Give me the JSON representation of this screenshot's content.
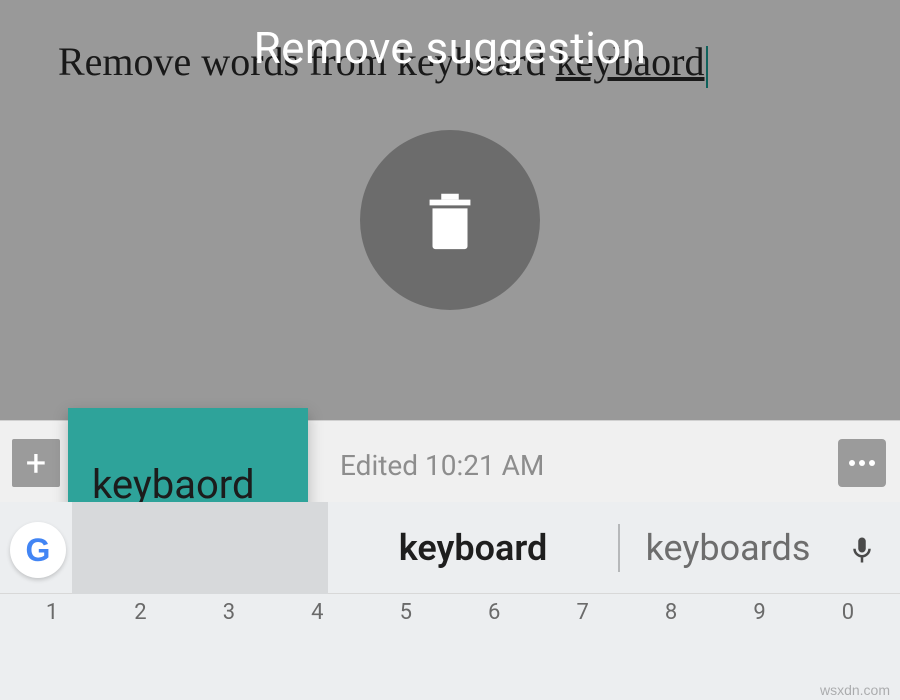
{
  "document": {
    "text_prefix": "Remove words from keyboard ",
    "misspelled_word": "keybaord"
  },
  "overlay": {
    "title": "Remove suggestion"
  },
  "toolbar": {
    "plus_label": "+",
    "edited_label": "Edited 10:21 AM"
  },
  "drag_chip": {
    "text": "keybaord"
  },
  "keyboard": {
    "g_label": "G",
    "suggestions": {
      "slot1": "",
      "slot2": "keyboard",
      "slot3": "keyboards"
    },
    "number_row": [
      {
        "num": "1",
        "letter": ""
      },
      {
        "num": "2",
        "letter": ""
      },
      {
        "num": "3",
        "letter": ""
      },
      {
        "num": "4",
        "letter": ""
      },
      {
        "num": "5",
        "letter": ""
      },
      {
        "num": "6",
        "letter": ""
      },
      {
        "num": "7",
        "letter": ""
      },
      {
        "num": "8",
        "letter": ""
      },
      {
        "num": "9",
        "letter": ""
      },
      {
        "num": "0",
        "letter": ""
      }
    ]
  },
  "watermark": "wsxdn.com"
}
